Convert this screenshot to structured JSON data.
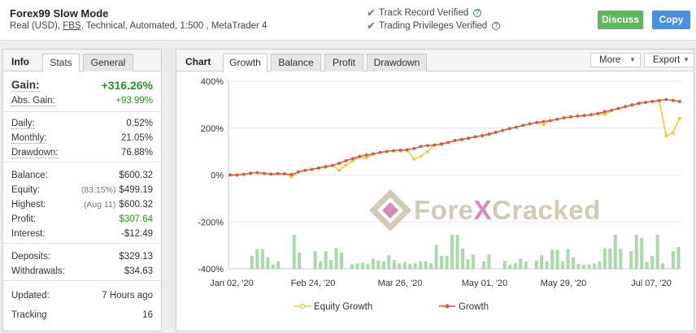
{
  "header": {
    "system_name": "Forex99 Slow Mode",
    "desc_before": "Real (USD), ",
    "desc_broker": "FBS",
    "desc_after": ", Technical, Automated, 1:500 , MetaTrader 4",
    "verified_1": "Track Record Verified",
    "verified_2": "Trading Privileges Verified",
    "qmark": "?",
    "discuss_label": "Discuss",
    "copy_label": "Copy"
  },
  "left_tabs": {
    "title": "Info",
    "stats": "Stats",
    "general": "General"
  },
  "stats": {
    "gain_label": "Gain:",
    "gain_value": "+316.26%",
    "abs_gain_label": "Abs. Gain:",
    "abs_gain_value": "+93.99%",
    "daily_label": "Daily:",
    "daily_value": "0.52%",
    "monthly_label": "Monthly:",
    "monthly_value": "21.05%",
    "drawdown_label": "Drawdown:",
    "drawdown_value": "76.88%",
    "balance_label": "Balance:",
    "balance_value": "$600.32",
    "equity_label": "Equity:",
    "equity_note": "(83.15%)",
    "equity_value": "$499.19",
    "highest_label": "Highest:",
    "highest_note": "(Aug 11)",
    "highest_value": "$600.32",
    "profit_label": "Profit:",
    "profit_value": "$307.64",
    "interest_label": "Interest:",
    "interest_value": "-$12.49",
    "deposits_label": "Deposits:",
    "deposits_value": "$329.13",
    "withdrawals_label": "Withdrawals:",
    "withdrawals_value": "$34.63",
    "updated_label": "Updated:",
    "updated_value": "7 Hours ago",
    "tracking_label": "Tracking",
    "tracking_value": "16"
  },
  "chart_tabs": {
    "title": "Chart",
    "growth": "Growth",
    "balance": "Balance",
    "profit": "Profit",
    "drawdown": "Drawdown",
    "more": "More",
    "export": "Export"
  },
  "watermark": {
    "part1": "Fore",
    "part2": "X",
    "part3": "Cracked"
  },
  "colors": {
    "growth": "#e34f3b",
    "equity": "#f4c81d",
    "bars": "#a5dba5",
    "gain_green": "#239a1f"
  },
  "chart_data": {
    "type": "line",
    "ylim": [
      -400,
      400
    ],
    "y_ticks": [
      400,
      200,
      0,
      -200,
      -400
    ],
    "y_tick_labels": [
      "400%",
      "200%",
      "0%",
      "-200%",
      "-400%"
    ],
    "x_labels": [
      "Jan 02, '20",
      "Feb 24, '20",
      "Mar 26, '20",
      "May 01, '20",
      "May 29, '20",
      "Jul 07, '20"
    ],
    "legend": [
      "Equity Growth",
      "Growth"
    ],
    "series": [
      {
        "name": "Growth",
        "values": [
          0,
          0,
          3,
          8,
          10,
          7,
          4,
          6,
          5,
          2,
          13,
          20,
          24,
          30,
          36,
          41,
          50,
          61,
          70,
          79,
          85,
          90,
          96,
          101,
          104,
          106,
          108,
          113,
          122,
          126,
          128,
          133,
          139,
          147,
          152,
          157,
          163,
          168,
          175,
          182,
          190,
          198,
          204,
          212,
          218,
          224,
          228,
          232,
          238,
          244,
          248,
          251,
          254,
          257,
          262,
          270,
          276,
          284,
          292,
          299,
          306,
          310,
          314,
          318,
          322,
          318,
          314
        ]
      },
      {
        "name": "Equity Growth",
        "values": [
          0,
          0,
          3,
          8,
          10,
          7,
          4,
          6,
          5,
          -8,
          13,
          20,
          24,
          30,
          33,
          42,
          20,
          42,
          60,
          78,
          72,
          90,
          96,
          100,
          104,
          103,
          105,
          68,
          80,
          100,
          128,
          130,
          139,
          147,
          150,
          157,
          163,
          168,
          172,
          182,
          190,
          198,
          204,
          212,
          218,
          224,
          214,
          232,
          238,
          244,
          248,
          251,
          254,
          258,
          262,
          258,
          276,
          284,
          292,
          299,
          306,
          310,
          314,
          314,
          168,
          180,
          242
        ]
      }
    ],
    "bars": {
      "values": [
        0,
        0,
        0,
        0,
        38,
        58,
        58,
        33,
        12,
        22,
        0,
        0,
        100,
        48,
        0,
        0,
        52,
        22,
        52,
        26,
        62,
        48,
        0,
        14,
        16,
        18,
        14,
        30,
        25,
        22,
        40,
        26,
        16,
        20,
        14,
        16,
        22,
        22,
        16,
        70,
        38,
        38,
        100,
        100,
        60,
        28,
        42,
        0,
        22,
        42,
        0,
        0,
        24,
        12,
        16,
        30,
        22,
        0,
        24,
        40,
        22,
        56,
        56,
        22,
        58,
        34,
        14,
        12,
        12,
        16,
        22,
        60,
        60,
        100,
        58,
        0,
        52,
        100,
        90,
        20,
        38,
        100,
        16,
        0,
        52,
        64
      ]
    }
  }
}
